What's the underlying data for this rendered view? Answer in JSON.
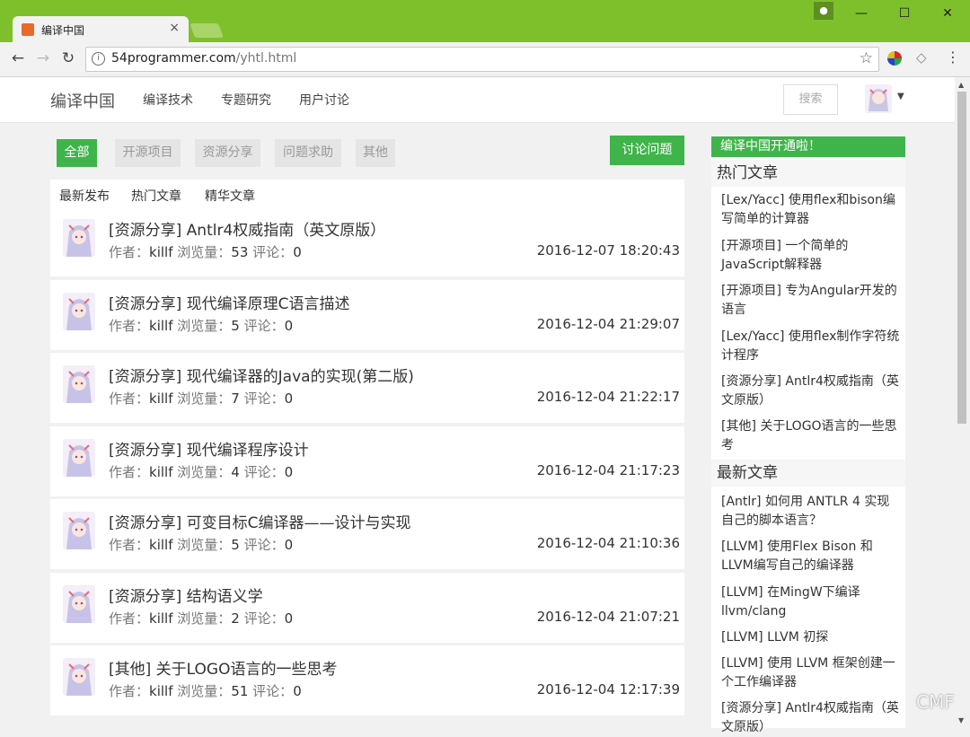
{
  "browser": {
    "tab_title": "编译中国",
    "tab_close": "×",
    "url_host": "54programmer.com",
    "url_path": "/yhtl.html",
    "minimize": "—",
    "maximize": "☐",
    "close": "✕"
  },
  "site": {
    "brand": "编译中国",
    "nav": [
      "编译技术",
      "专题研究",
      "用户讨论"
    ],
    "search_label": "搜索"
  },
  "filters": {
    "chips": [
      "全部",
      "开源项目",
      "资源分享",
      "问题求助",
      "其他"
    ],
    "discuss_button": "讨论问题"
  },
  "sort_tabs": [
    "最新发布",
    "热门文章",
    "精华文章"
  ],
  "posts": [
    {
      "title": "[资源分享] Antlr4权威指南（英文原版）",
      "author_label": "作者：",
      "author": "killf",
      "views_label": "浏览量：",
      "views": "53",
      "comments_label": "评论：",
      "comments": "0",
      "date": "2016-12-07 18:20:43"
    },
    {
      "title": "[资源分享] 现代编译原理C语言描述",
      "author_label": "作者：",
      "author": "killf",
      "views_label": "浏览量：",
      "views": "5",
      "comments_label": "评论：",
      "comments": "0",
      "date": "2016-12-04 21:29:07"
    },
    {
      "title": "[资源分享] 现代编译器的Java的实现(第二版)",
      "author_label": "作者：",
      "author": "killf",
      "views_label": "浏览量：",
      "views": "7",
      "comments_label": "评论：",
      "comments": "0",
      "date": "2016-12-04 21:22:17"
    },
    {
      "title": "[资源分享] 现代编译程序设计",
      "author_label": "作者：",
      "author": "killf",
      "views_label": "浏览量：",
      "views": "4",
      "comments_label": "评论：",
      "comments": "0",
      "date": "2016-12-04 21:17:23"
    },
    {
      "title": "[资源分享] 可变目标C编译器——设计与实现",
      "author_label": "作者：",
      "author": "killf",
      "views_label": "浏览量：",
      "views": "5",
      "comments_label": "评论：",
      "comments": "0",
      "date": "2016-12-04 21:10:36"
    },
    {
      "title": "[资源分享] 结构语义学",
      "author_label": "作者：",
      "author": "killf",
      "views_label": "浏览量：",
      "views": "2",
      "comments_label": "评论：",
      "comments": "0",
      "date": "2016-12-04 21:07:21"
    },
    {
      "title": "[其他] 关于LOGO语言的一些思考",
      "author_label": "作者：",
      "author": "killf",
      "views_label": "浏览量：",
      "views": "51",
      "comments_label": "评论：",
      "comments": "0",
      "date": "2016-12-04 12:17:39"
    }
  ],
  "sidebar": {
    "banner": "编译中国开通啦！",
    "hot_title": "热门文章",
    "hot": [
      "[Lex/Yacc] 使用flex和bison编写简单的计算器",
      "[开源项目] 一个简单的JavaScript解释器",
      "[开源项目] 专为Angular开发的语言",
      "[Lex/Yacc] 使用flex制作字符统计程序",
      "[资源分享] Antlr4权威指南（英文原版）",
      "[其他] 关于LOGO语言的一些思考"
    ],
    "new_title": "最新文章",
    "new": [
      "[Antlr] 如何用 ANTLR 4 实现自己的脚本语言？",
      "[LLVM] 使用Flex Bison 和LLVM编写自己的编译器",
      "[LLVM] 在MingW下编译llvm/clang",
      "[LLVM] LLVM 初探",
      "[LLVM] 使用 LLVM 框架创建一个工作编译器",
      "[资源分享] Antlr4权威指南（英文原版）"
    ]
  },
  "watermark": "CMF"
}
